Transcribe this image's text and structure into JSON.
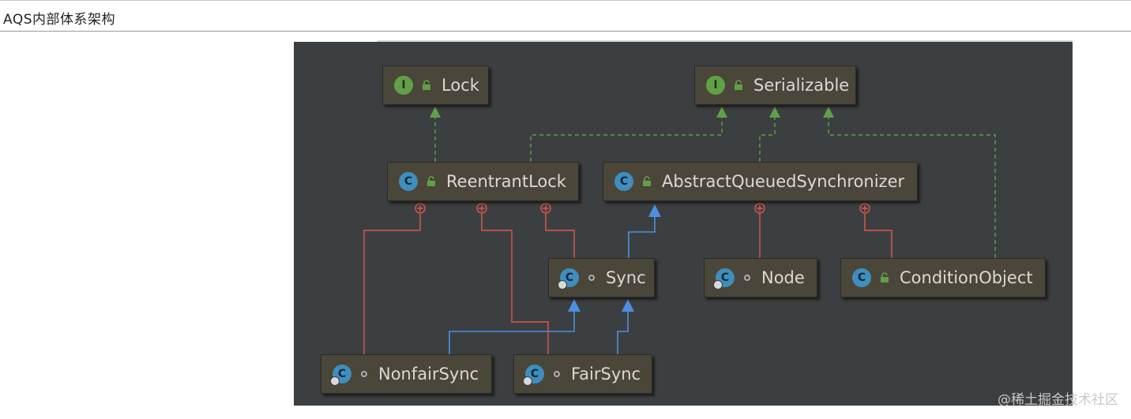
{
  "header": {
    "title": "AQS内部体系架构"
  },
  "diagram": {
    "nodes": [
      {
        "key": "lock",
        "label": "Lock",
        "kind": "I",
        "visibility": "public"
      },
      {
        "key": "serializable",
        "label": "Serializable",
        "kind": "I",
        "visibility": "public"
      },
      {
        "key": "reentrantlock",
        "label": "ReentrantLock",
        "kind": "C",
        "visibility": "public"
      },
      {
        "key": "aqs",
        "label": "AbstractQueuedSynchronizer",
        "kind": "C",
        "visibility": "public"
      },
      {
        "key": "sync",
        "label": "Sync",
        "kind": "C-static",
        "visibility": "package"
      },
      {
        "key": "node",
        "label": "Node",
        "kind": "C-static",
        "visibility": "package"
      },
      {
        "key": "conditionobject",
        "label": "ConditionObject",
        "kind": "C",
        "visibility": "public"
      },
      {
        "key": "nonfairsync",
        "label": "NonfairSync",
        "kind": "C-static",
        "visibility": "package"
      },
      {
        "key": "fairsync",
        "label": "FairSync",
        "kind": "C-static",
        "visibility": "package"
      }
    ],
    "colors": {
      "background": "#3c3f41",
      "node_fill": "#4a4639",
      "implements": "#62a048",
      "extends": "#4d8fe0",
      "inner_class": "#e0574f"
    }
  },
  "watermark": "@稀土掘金技术社区"
}
